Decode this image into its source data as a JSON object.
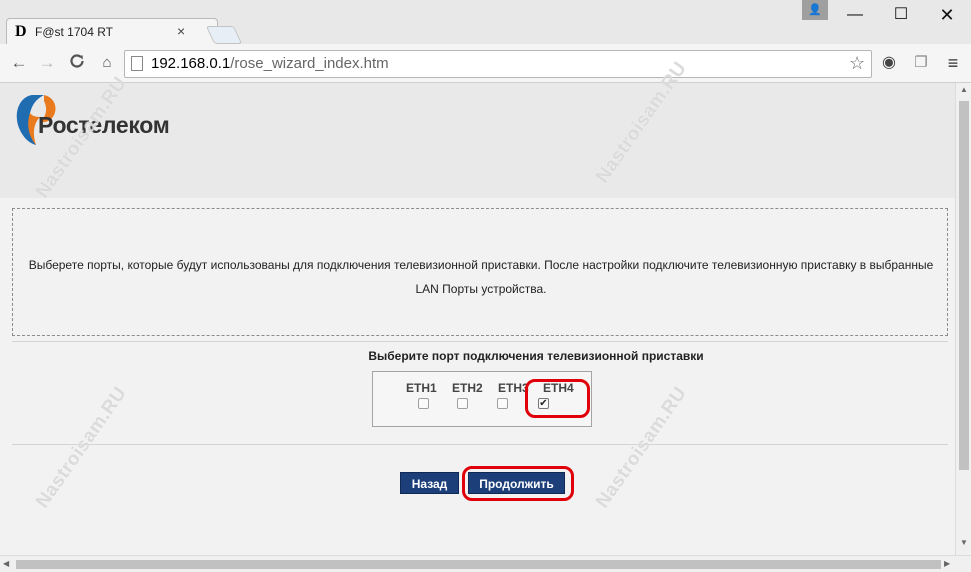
{
  "browser": {
    "tab": {
      "favicon": "D",
      "title": "F@st 1704 RT",
      "close": "×"
    },
    "window": {
      "user_glyph": "👤",
      "minimize": "—",
      "maximize": "☐",
      "close": "✕"
    },
    "toolbar": {
      "back": "←",
      "forward": "→",
      "reload": "C",
      "home": "⌂",
      "url_host": "192.168.0.1",
      "url_path": "/rose_wizard_index.htm",
      "star": "☆",
      "eye": "◉",
      "ext": "❐",
      "menu": "≡"
    }
  },
  "page": {
    "logo_text": "Ростелеком",
    "info_line1": "Выберете порты, которые будут использованы для подключения телевизионной приставки. После настройки подключите телевизионную приставку в выбранные",
    "info_line2": "LAN Порты устройства.",
    "ports_heading": "Выберите порт подключения телевизионной приставки",
    "ports": [
      {
        "label": "ETH1",
        "checked": false
      },
      {
        "label": "ETH2",
        "checked": false
      },
      {
        "label": "ETH3",
        "checked": false
      },
      {
        "label": "ETH4",
        "checked": true
      }
    ],
    "check_mark": "✔",
    "back_button": "Назад",
    "continue_button": "Продолжить"
  },
  "scrollbars": {
    "up": "▲",
    "down": "▼",
    "left": "◀",
    "right": "▶"
  },
  "watermark": "Nastroisam.RU",
  "colors": {
    "accent": "#1c3f7a",
    "highlight": "#e0000a",
    "logo_blue": "#1f6cb1",
    "logo_orange": "#e97a1e"
  }
}
